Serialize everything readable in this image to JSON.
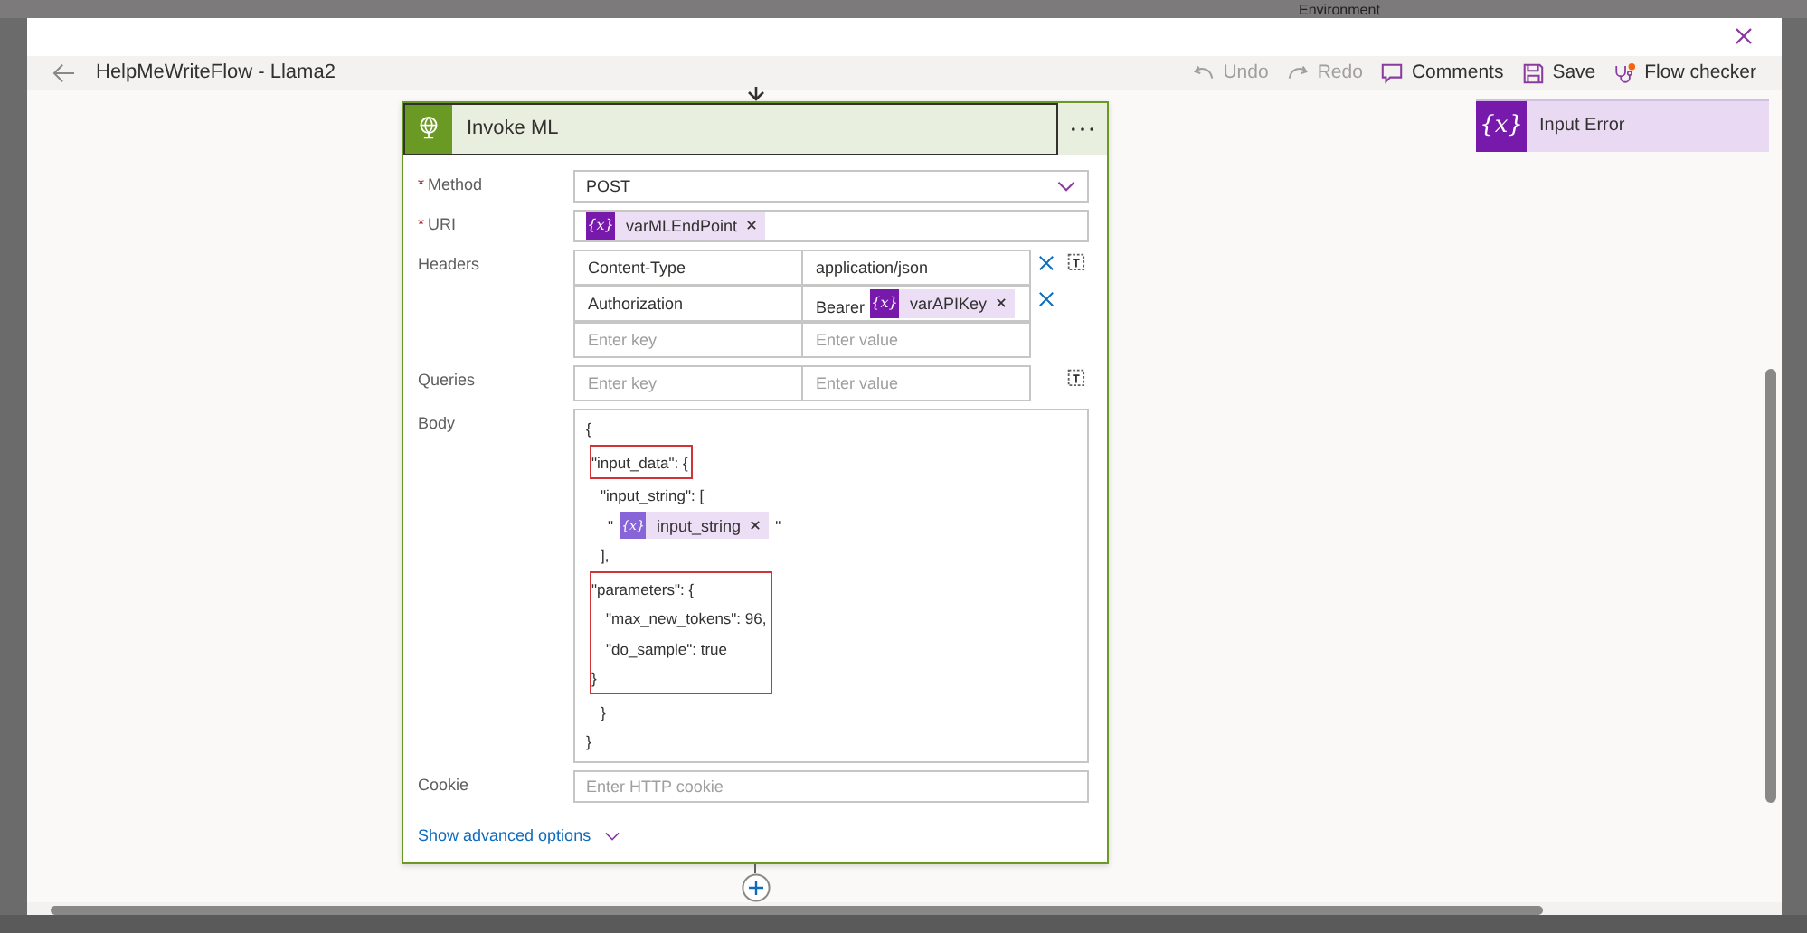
{
  "backdrop": {
    "label": "Environment"
  },
  "toolbar": {
    "title": "HelpMeWriteFlow - Llama2",
    "actions": [
      {
        "kind": "undo",
        "label": "Undo",
        "disabled": true
      },
      {
        "kind": "redo",
        "label": "Redo",
        "disabled": true
      },
      {
        "kind": "comments",
        "label": "Comments",
        "disabled": false
      },
      {
        "kind": "save",
        "label": "Save",
        "disabled": false
      },
      {
        "kind": "checker",
        "label": "Flow checker",
        "disabled": false
      }
    ]
  },
  "action_card": {
    "title": "Invoke ML",
    "method": {
      "label": "Method",
      "required_mark": "*",
      "value": "POST"
    },
    "uri": {
      "label": "URI",
      "required_mark": "*",
      "token_icon": "{x}",
      "token": "varMLEndPoint"
    },
    "headers": {
      "label": "Headers",
      "rows": [
        {
          "key": "Content-Type",
          "value": "application/json"
        },
        {
          "key": "Authorization",
          "value": "Bearer",
          "token_icon": "{x}",
          "token": "varAPIKey"
        }
      ],
      "key_placeholder": "Enter key",
      "value_placeholder": "Enter value"
    },
    "queries": {
      "label": "Queries",
      "key_placeholder": "Enter key",
      "value_placeholder": "Enter value"
    },
    "body": {
      "label": "Body",
      "blocks": [
        {
          "highlighted": false,
          "lines": [
            {
              "kind": "text",
              "text": "{"
            }
          ]
        },
        {
          "highlighted": true,
          "lines": [
            {
              "kind": "text",
              "text": "\"input_data\": {"
            }
          ]
        },
        {
          "highlighted": false,
          "lines": [
            {
              "kind": "text",
              "text": "  \"input_string\": ["
            },
            {
              "kind": "token",
              "before": "   \"",
              "token_icon": "{x}",
              "token": "input_string",
              "after": "\""
            },
            {
              "kind": "text",
              "text": "  ],"
            }
          ]
        },
        {
          "highlighted": true,
          "lines": [
            {
              "kind": "text",
              "text": "\"parameters\": {"
            },
            {
              "kind": "text",
              "text": "  \"max_new_tokens\": 96,"
            },
            {
              "kind": "text",
              "text": "  \"do_sample\": true"
            },
            {
              "kind": "text",
              "text": "}"
            }
          ]
        },
        {
          "highlighted": false,
          "lines": [
            {
              "kind": "text",
              "text": "  }"
            },
            {
              "kind": "text",
              "text": "}"
            }
          ]
        }
      ]
    },
    "cookie": {
      "label": "Cookie",
      "placeholder": "Enter HTTP cookie"
    },
    "advanced_link": "Show advanced options"
  },
  "variable_card": {
    "icon": "{x}",
    "title": "Input Error"
  }
}
